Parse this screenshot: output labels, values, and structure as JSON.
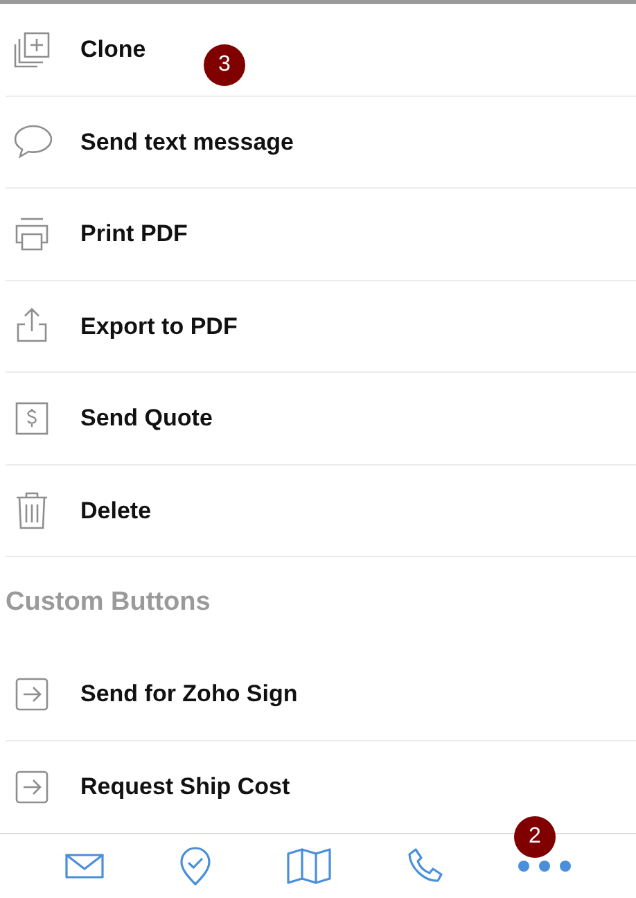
{
  "actions": [
    {
      "kind": "clone",
      "label": "Clone"
    },
    {
      "kind": "message",
      "label": "Send text message"
    },
    {
      "kind": "print",
      "label": "Print PDF"
    },
    {
      "kind": "export",
      "label": "Export to PDF"
    },
    {
      "kind": "quote",
      "label": "Send Quote"
    },
    {
      "kind": "delete",
      "label": "Delete"
    }
  ],
  "custom_buttons": {
    "title": "Custom Buttons",
    "items": [
      {
        "kind": "custom",
        "label": "Send for Zoho Sign"
      },
      {
        "kind": "custom",
        "label": "Request Ship Cost"
      }
    ]
  },
  "tab_bar": [
    {
      "kind": "mail"
    },
    {
      "kind": "checkin"
    },
    {
      "kind": "map"
    },
    {
      "kind": "call"
    },
    {
      "kind": "more"
    }
  ],
  "callouts": [
    {
      "label": "3"
    },
    {
      "label": "2"
    }
  ]
}
